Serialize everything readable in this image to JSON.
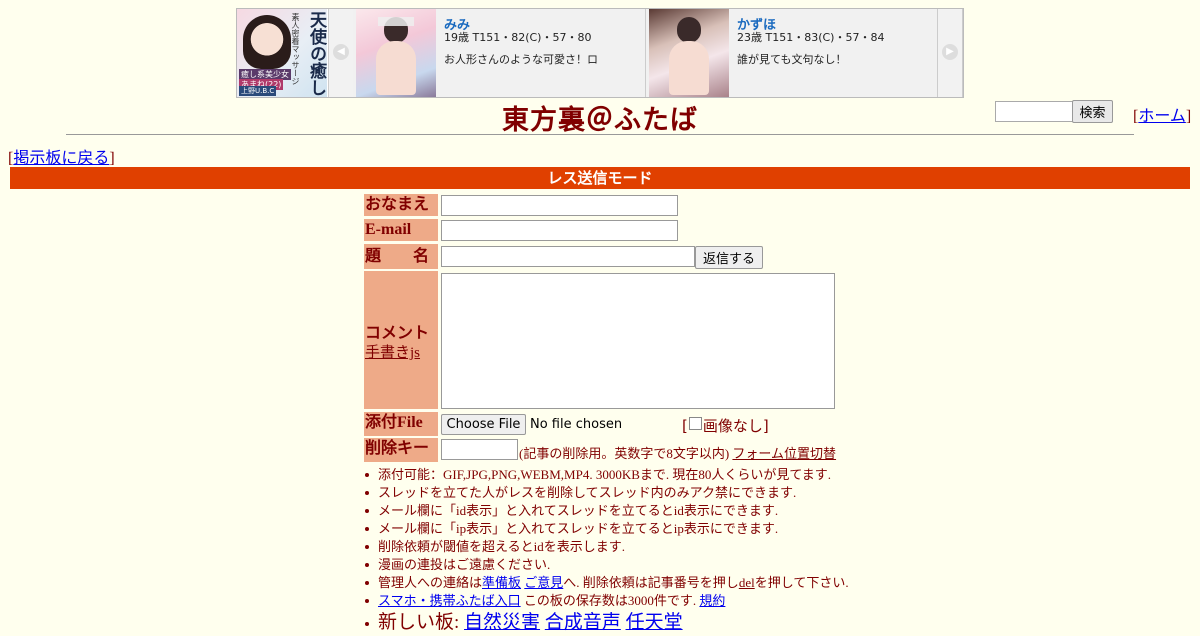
{
  "ad": {
    "banner": {
      "title": "天使の癒し",
      "subtitle": "素人密着マッサージ",
      "tag1": "癒し系美少女",
      "tag2": "あまね(22)",
      "tag3": "上野U.B.C"
    },
    "cards": [
      {
        "name": "みみ",
        "stats": "19歳 T151・82(C)・57・80",
        "desc": "お人形さんのような可愛さ！ロ"
      },
      {
        "name": "かずほ",
        "stats": "23歳 T151・83(C)・57・84",
        "desc": "誰が見ても文句なし！"
      }
    ],
    "prev_icon": "chevron-left-icon",
    "next_icon": "chevron-right-icon"
  },
  "header": {
    "title": "東方裏＠ふたば",
    "search_button": "検索",
    "home_link": "ホーム",
    "bracket_open": "[",
    "bracket_close": "]"
  },
  "nav": {
    "back_link": "掲示板に戻る"
  },
  "mode_bar": "レス送信モード",
  "form": {
    "name_label": "おなまえ",
    "email_label": "E-mail",
    "subject_label": "題　　名",
    "reply_button": "返信する",
    "comment_label": "コメント",
    "handwriting_link": "手書きjs",
    "file_label": "添付File",
    "file_button": "Choose File",
    "file_status": "No file chosen",
    "no_image_label": "画像なし",
    "delete_key_label": "削除キー",
    "delete_key_note": "(記事の削除用。英数字で8文字以内)",
    "form_position_link": "フォーム位置切替"
  },
  "notes": {
    "n1": "添付可能：GIF,JPG,PNG,WEBM,MP4. 3000KBまで. 現在80人くらいが見てます.",
    "n2": "スレッドを立てた人がレスを削除してスレッド内のみアク禁にできます.",
    "n3": "メール欄に「id表示」と入れてスレッドを立てるとid表示にできます.",
    "n4": "メール欄に「ip表示」と入れてスレッドを立てるとip表示にできます.",
    "n5": "削除依頼が閾値を超えるとidを表示します.",
    "n6": "漫画の連投はご遠慮ください.",
    "n7_pre": "管理人への連絡は",
    "n7_link1": "準備板",
    "n7_link2": "ご意見",
    "n7_mid": "へ. 削除依頼は記事番号を押し",
    "n7_link3": "del",
    "n7_post": "を押して下さい.",
    "n8_link1": "スマホ・携帯ふたば入口",
    "n8_mid": "この板の保存数は3000件です.",
    "n8_link2": "規約",
    "n9_pre": "新しい板: ",
    "n9_link1": "自然災害",
    "n9_link2": "合成音声",
    "n9_link3": "任天堂"
  }
}
